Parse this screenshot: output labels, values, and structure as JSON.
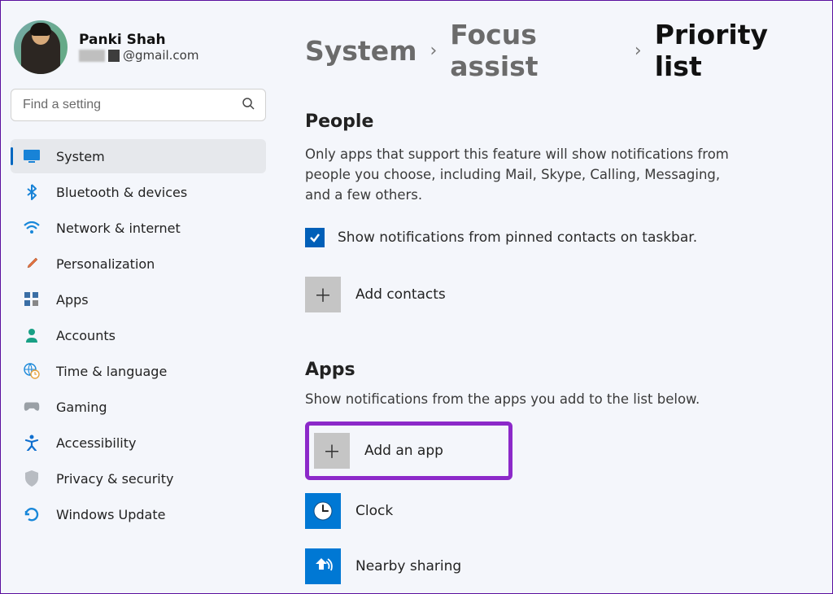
{
  "profile": {
    "name": "Panki Shah",
    "email_suffix": "@gmail.com"
  },
  "search": {
    "placeholder": "Find a setting"
  },
  "nav": {
    "system": "System",
    "bluetooth": "Bluetooth & devices",
    "network": "Network & internet",
    "personalization": "Personalization",
    "apps": "Apps",
    "accounts": "Accounts",
    "time": "Time & language",
    "gaming": "Gaming",
    "accessibility": "Accessibility",
    "privacy": "Privacy & security",
    "update": "Windows Update"
  },
  "breadcrumb": {
    "root": "System",
    "mid": "Focus assist",
    "current": "Priority list"
  },
  "people": {
    "heading": "People",
    "desc": "Only apps that support this feature will show notifications from people you choose, including Mail, Skype, Calling, Messaging, and a few others.",
    "checkbox_label": "Show notifications from pinned contacts on taskbar.",
    "add_contacts": "Add contacts"
  },
  "apps_section": {
    "heading": "Apps",
    "desc": "Show notifications from the apps you add to the list below.",
    "add_app": "Add an app",
    "items": [
      {
        "label": "Clock"
      },
      {
        "label": "Nearby sharing"
      }
    ]
  }
}
